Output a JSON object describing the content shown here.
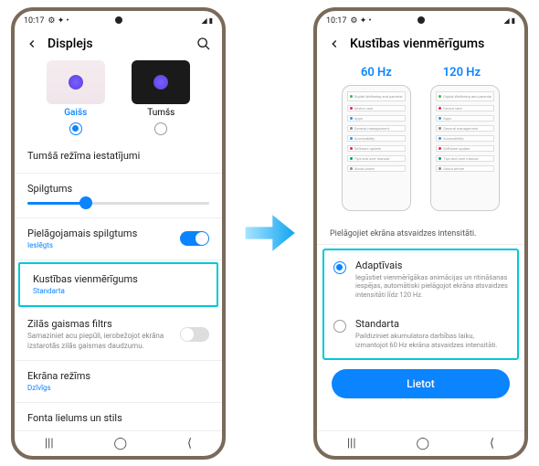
{
  "statusbar": {
    "time": "10:17",
    "right": "◢ ▮"
  },
  "left": {
    "title": "Displejs",
    "theme": {
      "light": "Gaišs",
      "dark": "Tumšs"
    },
    "dark_settings": "Tumšā režīma iestatījumi",
    "brightness": "Spilgtums",
    "adaptive_b": {
      "title": "Pielāgojamais spilgtums",
      "sub": "Ieslēgts"
    },
    "motion": {
      "title": "Kustības vienmērīgums",
      "sub": "Standarta"
    },
    "bluelight": {
      "title": "Zilās gaismas filtrs",
      "sub": "Samaziniet acu piepūli, ierobežojot ekrāna izstarotās zilās gaismas daudzumu."
    },
    "screenmode": {
      "title": "Ekrāna režīms",
      "sub": "Dzīvīgs"
    },
    "fontsize": "Fonta lielums un stils"
  },
  "right": {
    "title": "Kustības vienmērīgums",
    "hz60": "60 Hz",
    "hz120": "120 Hz",
    "desc": "Pielāgojiet ekrāna atsvaidzes intensitāti.",
    "opt1": {
      "title": "Adaptīvais",
      "sub": "Iegūstiet vienmērīgākas animācijas un ritināšanas iespējas, automātiski pielāgojot ekrāna atsvaidzes intensitāti līdz 120 Hz."
    },
    "opt2": {
      "title": "Standarta",
      "sub": "Paildiziniet akumulatora darbības laiku, izmantojot 60 Hz ekrāna atsvaidzes intensitāti."
    },
    "apply": "Lietot"
  }
}
